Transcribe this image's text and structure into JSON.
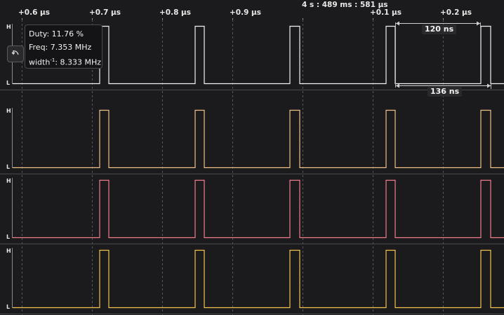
{
  "ruler": {
    "timestamp": "4 s : 489 ms : 581 µs",
    "ticks": [
      "+0.6 µs",
      "+0.7 µs",
      "+0.8 µs",
      "+0.9 µs",
      "+0.1 µs",
      "+0.2 µs"
    ]
  },
  "tooltip": {
    "duty": "Duty: 11.76 %",
    "freq": "Freq: 7.353 MHz",
    "width_prefix": "width",
    "width_exp": "-1",
    "width_value": ": 8.333 MHz"
  },
  "measurements": {
    "pulse_width": "120 ns",
    "period": "136 ns"
  },
  "channels": [
    {
      "color": "#f2f2f2",
      "high_label": "H",
      "low_label": "L"
    },
    {
      "color": "#f0c088",
      "high_label": "H",
      "low_label": "L"
    },
    {
      "color": "#f07c8a",
      "high_label": "H",
      "low_label": "L"
    },
    {
      "color": "#f3c24d",
      "high_label": "H",
      "low_label": "L"
    }
  ],
  "icons": {
    "undo": "undo-arrow-icon"
  }
}
